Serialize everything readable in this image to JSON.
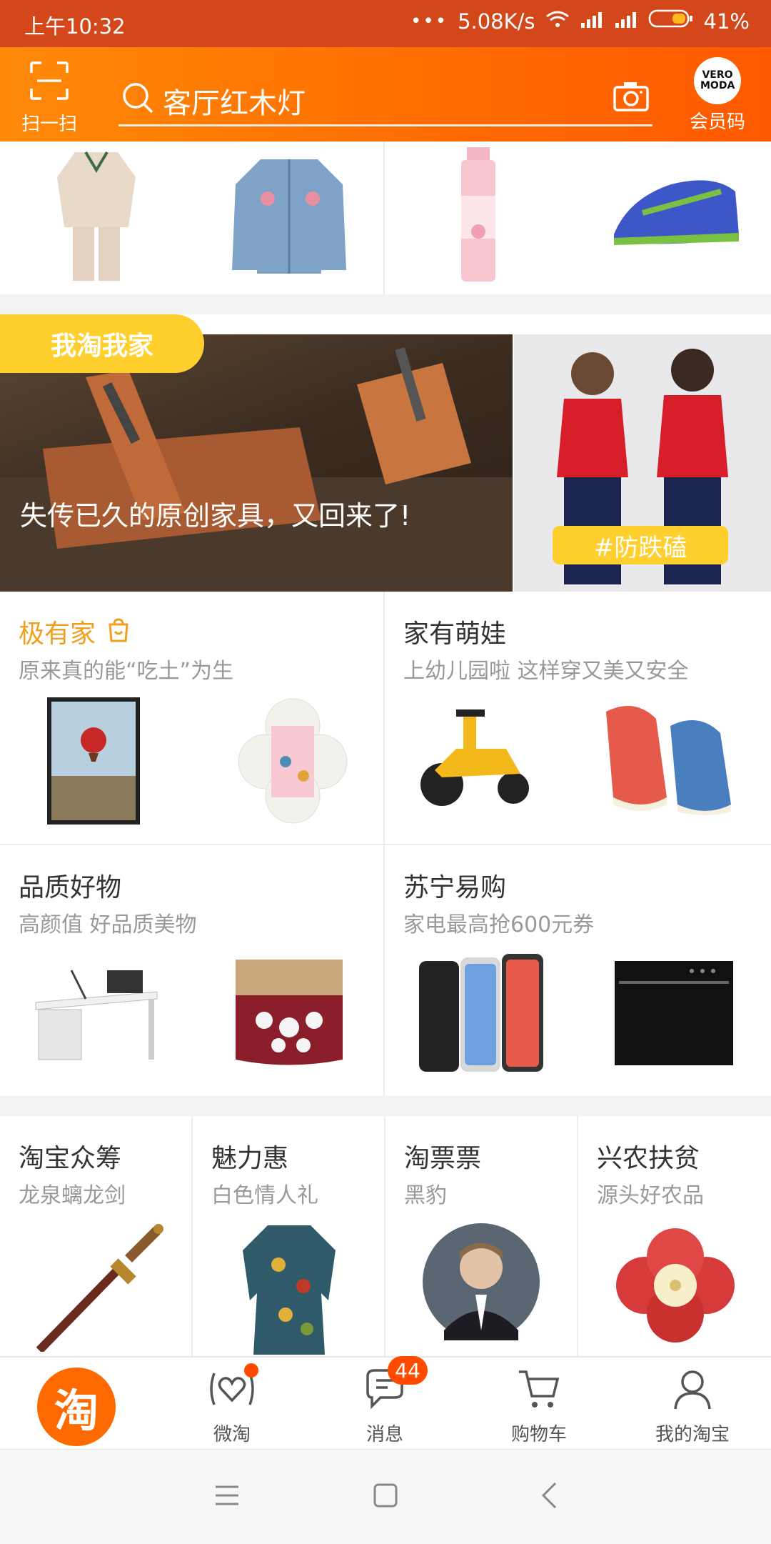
{
  "status_bar": {
    "time": "上午10:32",
    "network_speed": "5.08K/s",
    "battery": "41%"
  },
  "header": {
    "scan_label": "扫一扫",
    "search_placeholder": "客厅红木灯",
    "member_label": "会员码",
    "brand_logo_text": "VERO MODA"
  },
  "banner": {
    "tag": "我淘我家",
    "caption": "失传已久的原创家具，又回来了!",
    "side_tag": "#防跌磕"
  },
  "cards": [
    {
      "title": "极有家",
      "subtitle": "原来真的能“吃土”为生"
    },
    {
      "title": "家有萌娃",
      "subtitle": "上幼儿园啦 这样穿又美又安全"
    },
    {
      "title": "品质好物",
      "subtitle": "高颜值 好品质美物"
    },
    {
      "title": "苏宁易购",
      "subtitle": "家电最高抢600元券"
    }
  ],
  "small_cards": [
    {
      "title": "淘宝众筹",
      "subtitle": "龙泉螭龙剑"
    },
    {
      "title": "魅力惠",
      "subtitle": "白色情人礼"
    },
    {
      "title": "淘票票",
      "subtitle": "黑豹"
    },
    {
      "title": "兴农扶贫",
      "subtitle": "源头好农品"
    }
  ],
  "tabs": [
    {
      "label": "淘",
      "icon": "taobao-home-icon"
    },
    {
      "label": "微淘",
      "icon": "weitao-icon"
    },
    {
      "label": "消息",
      "icon": "message-icon",
      "badge": "44"
    },
    {
      "label": "购物车",
      "icon": "cart-icon"
    },
    {
      "label": "我的淘宝",
      "icon": "user-icon"
    }
  ],
  "colors": {
    "brand_orange": "#ff6a00",
    "status_bar": "#d4471b",
    "badge_red": "#ff4a00",
    "jiyoujia_orange": "#f0a020"
  }
}
